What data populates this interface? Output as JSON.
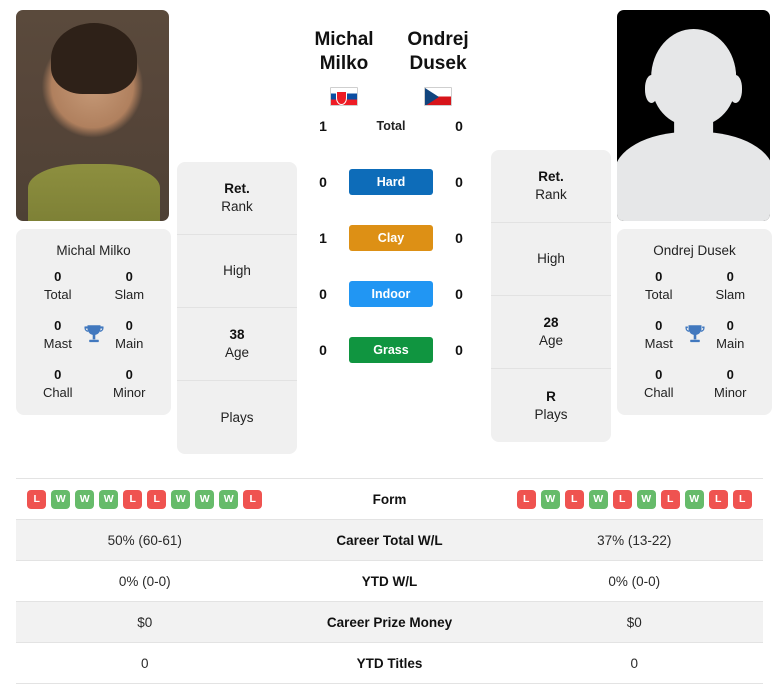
{
  "players": {
    "left": {
      "name": "Michal Milko",
      "flag": "slovakia-flag",
      "photo_type": "player-photo",
      "rank_value": "Ret.",
      "rank_label": "Rank",
      "high_value": "",
      "high_label": "High",
      "age_value": "38",
      "age_label": "Age",
      "plays_value": "",
      "plays_label": "Plays",
      "titles": {
        "total_value": "0",
        "total_label": "Total",
        "slam_value": "0",
        "slam_label": "Slam",
        "mast_value": "0",
        "mast_label": "Mast",
        "main_value": "0",
        "main_label": "Main",
        "chall_value": "0",
        "chall_label": "Chall",
        "minor_value": "0",
        "minor_label": "Minor"
      }
    },
    "right": {
      "name": "Ondrej Dusek",
      "flag": "czech-republic-flag",
      "photo_type": "placeholder-avatar",
      "rank_value": "Ret.",
      "rank_label": "Rank",
      "high_value": "",
      "high_label": "High",
      "age_value": "28",
      "age_label": "Age",
      "plays_value": "R",
      "plays_label": "Plays",
      "titles": {
        "total_value": "0",
        "total_label": "Total",
        "slam_value": "0",
        "slam_label": "Slam",
        "mast_value": "0",
        "mast_label": "Mast",
        "main_value": "0",
        "main_label": "Main",
        "chall_value": "0",
        "chall_label": "Chall",
        "minor_value": "0",
        "minor_label": "Minor"
      }
    }
  },
  "head_to_head": {
    "rows": [
      {
        "label": "Total",
        "left": "1",
        "right": "0",
        "color": "",
        "pill": false
      },
      {
        "label": "Hard",
        "left": "0",
        "right": "0",
        "color": "#0d6cb9",
        "pill": true
      },
      {
        "label": "Clay",
        "left": "1",
        "right": "0",
        "color": "#dd9015",
        "pill": true
      },
      {
        "label": "Indoor",
        "left": "0",
        "right": "0",
        "color": "#2196f3",
        "pill": true
      },
      {
        "label": "Grass",
        "left": "0",
        "right": "0",
        "color": "#109540",
        "pill": true
      }
    ]
  },
  "comparison": {
    "form": {
      "label": "Form",
      "left": [
        "L",
        "W",
        "W",
        "W",
        "L",
        "L",
        "W",
        "W",
        "W",
        "L"
      ],
      "right": [
        "L",
        "W",
        "L",
        "W",
        "L",
        "W",
        "L",
        "W",
        "L",
        "L"
      ]
    },
    "rows": [
      {
        "label": "Career Total W/L",
        "left": "50% (60-61)",
        "right": "37% (13-22)"
      },
      {
        "label": "YTD W/L",
        "left": "0% (0-0)",
        "right": "0% (0-0)"
      },
      {
        "label": "Career Prize Money",
        "left": "$0",
        "right": "$0"
      },
      {
        "label": "YTD Titles",
        "left": "0",
        "right": "0"
      }
    ]
  },
  "colors": {
    "win_badge": "#66bb6a",
    "loss_badge": "#ef5350",
    "trophy": "#4178be",
    "card_bg": "#f0f0f0"
  }
}
